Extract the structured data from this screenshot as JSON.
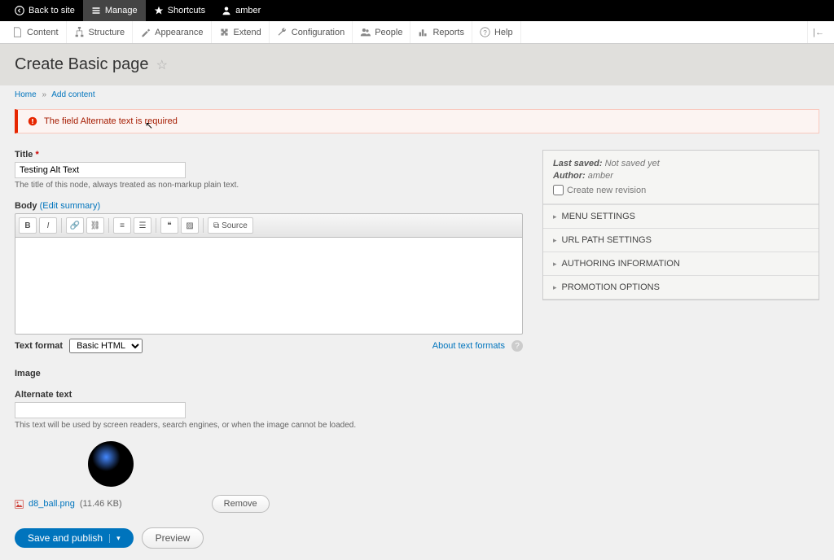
{
  "topbar": {
    "back": "Back to site",
    "manage": "Manage",
    "shortcuts": "Shortcuts",
    "user": "amber"
  },
  "admin_menu": {
    "items": [
      "Content",
      "Structure",
      "Appearance",
      "Extend",
      "Configuration",
      "People",
      "Reports",
      "Help"
    ],
    "collapse": "|←"
  },
  "page": {
    "title": "Create Basic page",
    "crumb_home": "Home",
    "crumb_add": "Add content"
  },
  "error": {
    "msg": "The field Alternate text is required"
  },
  "form": {
    "title_label": "Title",
    "title_value": "Testing Alt Text",
    "title_hint": "The title of this node, always treated as non-markup plain text.",
    "body_label": "Body",
    "edit_summary": "(Edit summary)",
    "tb_bold": "B",
    "tb_italic": "I",
    "tb_quote": "❝",
    "tb_source": "Source",
    "format_label": "Text format",
    "format_value": "Basic HTML",
    "about": "About text formats",
    "image_label": "Image",
    "alt_label": "Alternate text",
    "alt_hint": "This text will be used by screen readers, search engines, or when the image cannot be loaded.",
    "file_name": "d8_ball.png",
    "file_size": "(11.46 KB)",
    "remove": "Remove",
    "save": "Save and publish",
    "preview": "Preview"
  },
  "meta": {
    "saved_label": "Last saved:",
    "saved_val": "Not saved yet",
    "author_label": "Author:",
    "author_val": "amber",
    "revision": "Create new revision",
    "menu": "MENU SETTINGS",
    "url": "URL PATH SETTINGS",
    "authoring": "AUTHORING INFORMATION",
    "promo": "PROMOTION OPTIONS"
  }
}
